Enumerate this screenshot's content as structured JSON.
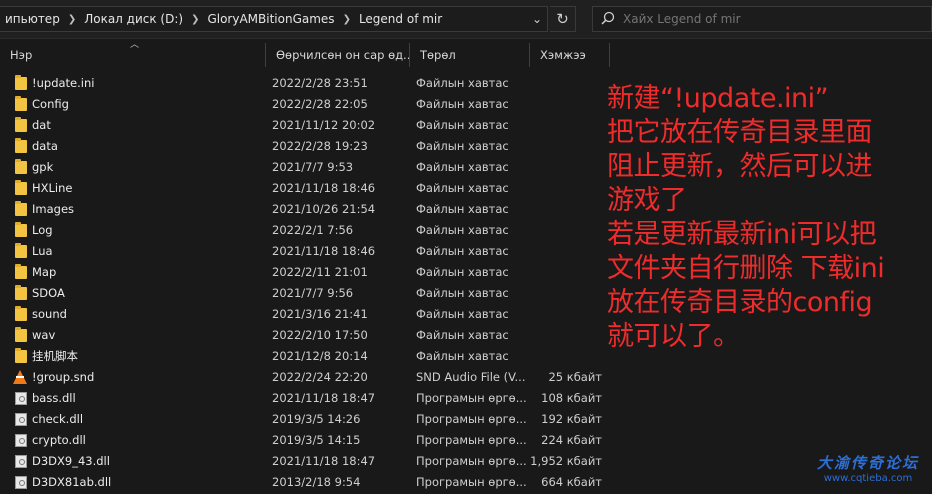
{
  "address": {
    "breadcrumbs": [
      "ипьютер",
      "Локал диск (D:)",
      "GloryAMBitionGames",
      "Legend of mir"
    ],
    "dropdown_glyph": "⌄",
    "refresh_glyph": "↻"
  },
  "search": {
    "placeholder": "Хайх Legend of mir"
  },
  "columns": {
    "name": "Нэр",
    "date": "Өөрчилсөн он сар өд...",
    "type": "Төрөл",
    "size": "Хэмжээ"
  },
  "files": [
    {
      "name": "!update.ini",
      "date": "2022/2/28 23:51",
      "type": "Файлын хавтас",
      "size": "",
      "icon": "folder"
    },
    {
      "name": "Config",
      "date": "2022/2/28 22:05",
      "type": "Файлын хавтас",
      "size": "",
      "icon": "folder"
    },
    {
      "name": "dat",
      "date": "2021/11/12 20:02",
      "type": "Файлын хавтас",
      "size": "",
      "icon": "folder"
    },
    {
      "name": "data",
      "date": "2022/2/28 19:23",
      "type": "Файлын хавтас",
      "size": "",
      "icon": "folder"
    },
    {
      "name": "gpk",
      "date": "2021/7/7 9:53",
      "type": "Файлын хавтас",
      "size": "",
      "icon": "folder"
    },
    {
      "name": "HXLine",
      "date": "2021/11/18 18:46",
      "type": "Файлын хавтас",
      "size": "",
      "icon": "folder"
    },
    {
      "name": "Images",
      "date": "2021/10/26 21:54",
      "type": "Файлын хавтас",
      "size": "",
      "icon": "folder"
    },
    {
      "name": "Log",
      "date": "2022/2/1 7:56",
      "type": "Файлын хавтас",
      "size": "",
      "icon": "folder"
    },
    {
      "name": "Lua",
      "date": "2021/11/18 18:46",
      "type": "Файлын хавтас",
      "size": "",
      "icon": "folder"
    },
    {
      "name": "Map",
      "date": "2022/2/11 21:01",
      "type": "Файлын хавтас",
      "size": "",
      "icon": "folder"
    },
    {
      "name": "SDOA",
      "date": "2021/7/7 9:56",
      "type": "Файлын хавтас",
      "size": "",
      "icon": "folder"
    },
    {
      "name": "sound",
      "date": "2021/3/16 21:41",
      "type": "Файлын хавтас",
      "size": "",
      "icon": "folder"
    },
    {
      "name": "wav",
      "date": "2022/2/10 17:50",
      "type": "Файлын хавтас",
      "size": "",
      "icon": "folder"
    },
    {
      "name": "挂机脚本",
      "date": "2021/12/8 20:14",
      "type": "Файлын хавтас",
      "size": "",
      "icon": "folder"
    },
    {
      "name": "!group.snd",
      "date": "2022/2/24 22:20",
      "type": "SND Audio File (V...",
      "size": "25 кбайт",
      "icon": "snd"
    },
    {
      "name": "bass.dll",
      "date": "2021/11/18 18:47",
      "type": "Програмын өргө...",
      "size": "108 кбайт",
      "icon": "dll"
    },
    {
      "name": "check.dll",
      "date": "2019/3/5 14:26",
      "type": "Програмын өргө...",
      "size": "192 кбайт",
      "icon": "dll"
    },
    {
      "name": "crypto.dll",
      "date": "2019/3/5 14:15",
      "type": "Програмын өргө...",
      "size": "224 кбайт",
      "icon": "dll"
    },
    {
      "name": "D3DX9_43.dll",
      "date": "2021/11/18 18:47",
      "type": "Програмын өргө...",
      "size": "1,952 кбайт",
      "icon": "dll"
    },
    {
      "name": "D3DX81ab.dll",
      "date": "2013/2/18 9:54",
      "type": "Програмын өргө...",
      "size": "664 кбайт",
      "icon": "dll"
    }
  ],
  "annotation": {
    "lines": [
      "新建“!update.ini”",
      "把它放在传奇目录里面",
      "阻止更新，然后可以进",
      "游戏了",
      "若是更新最新ini可以把",
      "文件夹自行删除 下载ini",
      "放在传奇目录的config",
      "就可以了。"
    ],
    "color": "#ef2b2b"
  },
  "watermark": {
    "title": "大渝传奇论坛",
    "url": "www.cqtieba.com"
  }
}
